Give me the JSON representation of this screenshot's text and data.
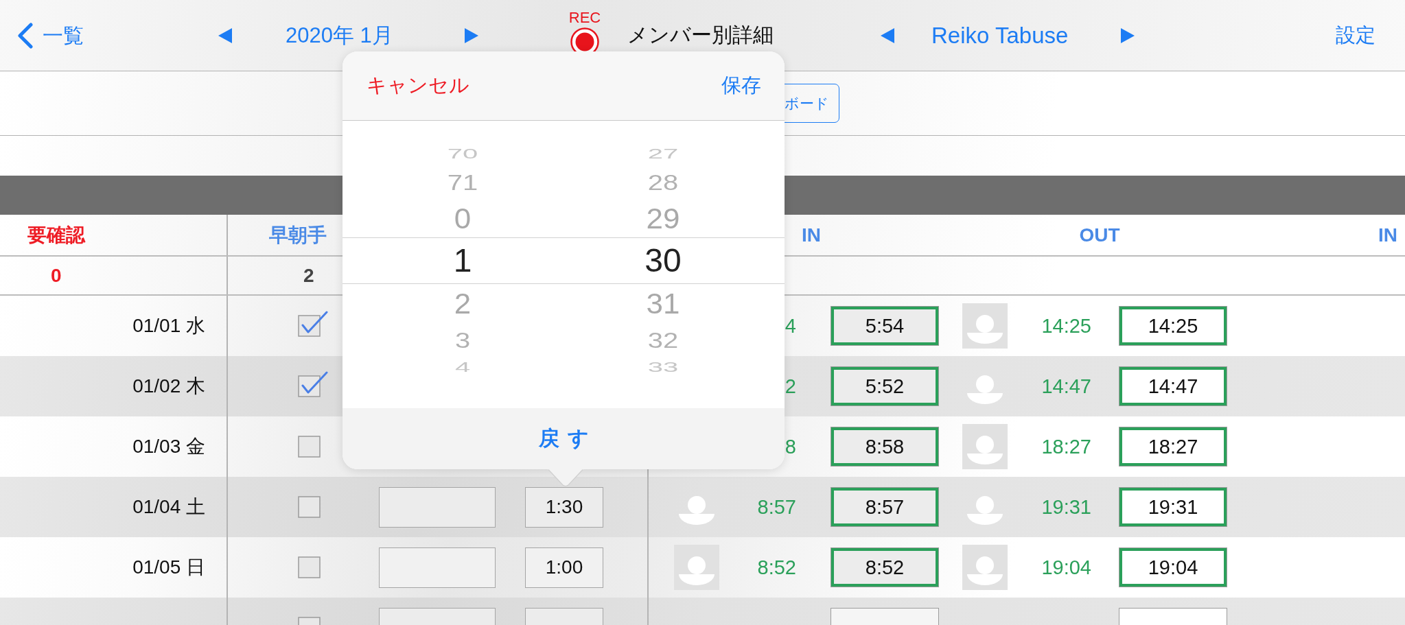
{
  "nav_bar": {
    "back": "一覧",
    "month": "2020年 1月",
    "rec": "REC",
    "title": "メンバー別詳細",
    "member": "Reiko Tabuse",
    "settings": "設定"
  },
  "toolbar": {
    "button": "ボード"
  },
  "table": {
    "columns": [
      {
        "label": "要確認",
        "alert": true
      },
      {
        "label": "早朝手",
        "alert": false
      },
      {
        "label": "IN",
        "alert": false
      },
      {
        "label": "OUT",
        "alert": false
      },
      {
        "label": "IN",
        "alert": false
      }
    ],
    "totals": [
      {
        "value": "0",
        "alert": true
      },
      {
        "value": "2",
        "alert": false
      }
    ],
    "rows": [
      {
        "date": "01/01 水",
        "checked": true,
        "in_time": "4",
        "in_box": {
          "value": "5:54",
          "confirmed": true
        },
        "out_avatar": {
          "framed": true
        },
        "out_time": "14:25",
        "out_box": {
          "value": "14:25",
          "confirmed": true
        }
      },
      {
        "date": "01/02 木",
        "checked": true,
        "in_time": "2",
        "in_box": {
          "value": "5:52",
          "confirmed": true
        },
        "out_avatar": {
          "framed": false
        },
        "out_time": "14:47",
        "out_box": {
          "value": "14:47",
          "confirmed": true
        }
      },
      {
        "date": "01/03 金",
        "checked": false,
        "in_time": "8",
        "in_box": {
          "value": "8:58",
          "confirmed": true
        },
        "out_avatar": {
          "framed": true
        },
        "out_time": "18:27",
        "out_box": {
          "value": "18:27",
          "confirmed": true
        }
      },
      {
        "date": "01/04 土",
        "checked": false,
        "fields_shown": true,
        "duration": "1:30",
        "in_avatar": {
          "framed": false
        },
        "in_time": "8:57",
        "in_box": {
          "value": "8:57",
          "confirmed": true
        },
        "out_avatar": {
          "framed": false
        },
        "out_time": "19:31",
        "out_box": {
          "value": "19:31",
          "confirmed": true
        }
      },
      {
        "date": "01/05 日",
        "checked": false,
        "fields_shown": true,
        "duration": "1:00",
        "in_avatar": {
          "framed": true
        },
        "in_time": "8:52",
        "in_box": {
          "value": "8:52",
          "confirmed": true
        },
        "out_avatar": {
          "framed": true
        },
        "out_time": "19:04",
        "out_box": {
          "value": "19:04",
          "confirmed": true
        }
      },
      {
        "checked": false,
        "fields_shown": true,
        "in_box": {
          "confirmed": false
        },
        "out_box": {
          "confirmed": false
        }
      }
    ]
  },
  "popover": {
    "cancel": "キャンセル",
    "save": "保存",
    "columns": [
      {
        "items": [
          {
            "label": "70",
            "selected": false
          },
          {
            "label": "71",
            "selected": false
          },
          {
            "label": "0",
            "selected": false
          },
          {
            "label": "1",
            "selected": true
          },
          {
            "label": "2",
            "selected": false
          },
          {
            "label": "3",
            "selected": false
          },
          {
            "label": "4",
            "selected": false
          }
        ]
      },
      {
        "items": [
          {
            "label": "27",
            "selected": false
          },
          {
            "label": "28",
            "selected": false
          },
          {
            "label": "29",
            "selected": false
          },
          {
            "label": "30",
            "selected": true
          },
          {
            "label": "31",
            "selected": false
          },
          {
            "label": "32",
            "selected": false
          },
          {
            "label": "33",
            "selected": false
          }
        ]
      }
    ],
    "revert": "戻す"
  }
}
